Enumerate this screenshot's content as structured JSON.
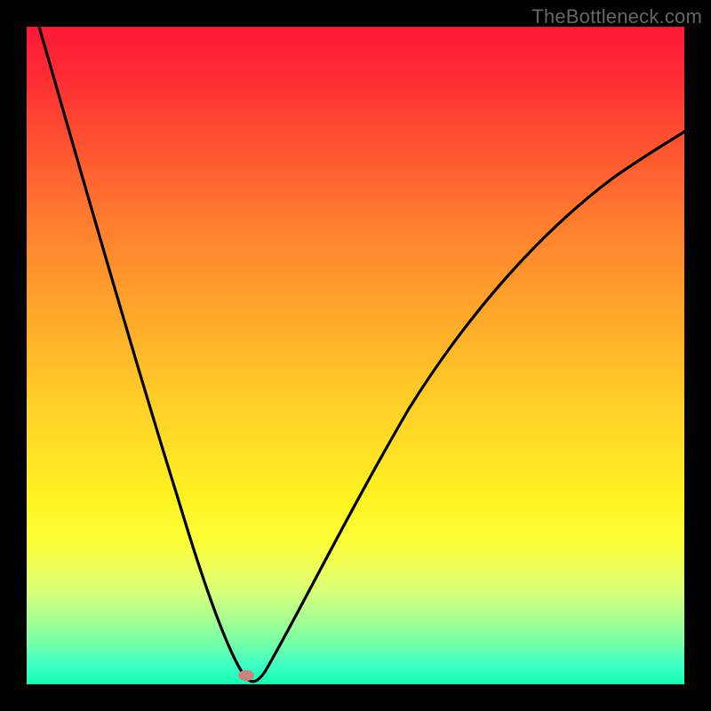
{
  "watermark": "TheBottleneck.com",
  "colors": {
    "page_bg": "#000000",
    "curve_stroke": "#000000",
    "dot_fill": "#cf8181",
    "watermark_color": "#666666"
  },
  "chart_data": {
    "type": "line",
    "title": "",
    "xlabel": "",
    "ylabel": "",
    "xlim": [
      0,
      100
    ],
    "ylim": [
      0,
      100
    ],
    "minimum_marker": {
      "x": 33,
      "y": 1.5
    },
    "series": [
      {
        "name": "bottleneck-curve",
        "x": [
          2,
          5,
          8,
          11,
          14,
          17,
          20,
          23,
          26,
          29,
          31,
          33,
          35,
          38,
          42,
          47,
          53,
          60,
          68,
          77,
          87,
          100
        ],
        "values": [
          100,
          90,
          80,
          70,
          60,
          50,
          40,
          30,
          20,
          10,
          4,
          1,
          4,
          12,
          22,
          33,
          44,
          54,
          63,
          71,
          78,
          85
        ]
      }
    ],
    "gradient_stops": [
      {
        "pos": 0.0,
        "color": "#ff1836"
      },
      {
        "pos": 0.4,
        "color": "#ff932c"
      },
      {
        "pos": 0.7,
        "color": "#fff024"
      },
      {
        "pos": 0.88,
        "color": "#c6ff82"
      },
      {
        "pos": 1.0,
        "color": "#12ffb6"
      }
    ]
  }
}
